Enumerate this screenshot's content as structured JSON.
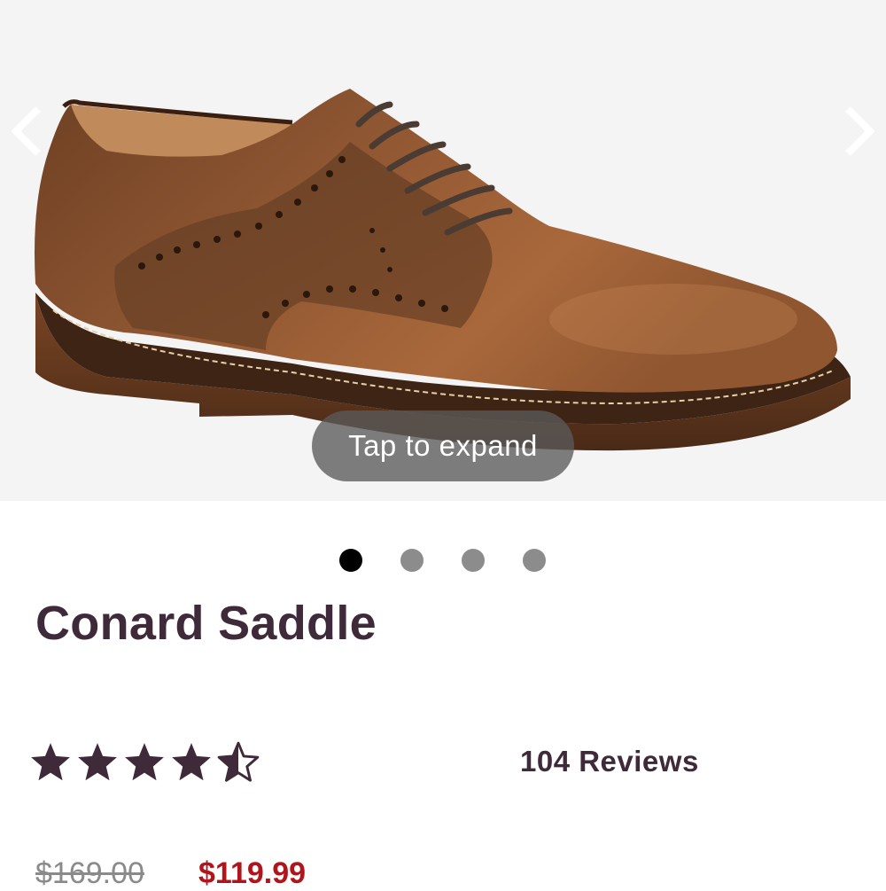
{
  "gallery": {
    "image_alt": "Conard Saddle shoe",
    "expand_label": "Tap to expand",
    "slide_count": 4,
    "active_slide": 1,
    "prev_icon": "chevron-left-icon",
    "next_icon": "chevron-right-icon"
  },
  "product": {
    "title": "Conard Saddle",
    "rating": 4.5,
    "rating_max": 5,
    "reviews_label": "104 Reviews",
    "original_price": "$169.00",
    "sale_price": "$119.99"
  },
  "colors": {
    "title": "#3f2a3a",
    "sale_price": "#b0151c",
    "dot_active": "#000000",
    "dot_inactive": "#8c8c8c"
  }
}
